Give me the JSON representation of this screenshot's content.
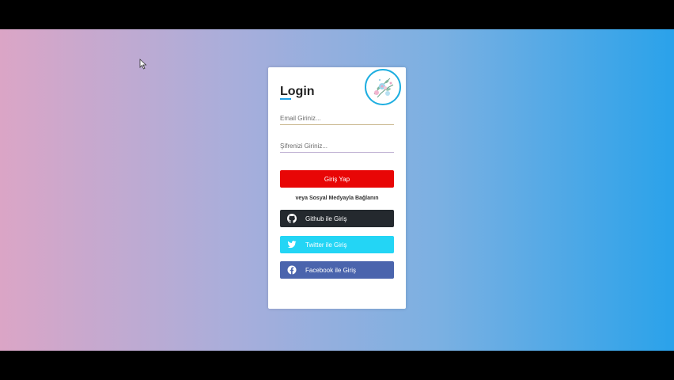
{
  "login": {
    "title": "Login",
    "email_placeholder": "Email Giriniz...",
    "password_placeholder": "Şifrenizi Giriniz...",
    "submit_label": "Giriş Yap",
    "social_text": "veya Sosyal Medyayla Bağlanın"
  },
  "social": {
    "github_label": "Github ile Giriş",
    "twitter_label": "Twitter ile Giriş",
    "facebook_label": "Facebook ile Giriş"
  },
  "colors": {
    "submit": "#e80606",
    "github": "#24292e",
    "twitter": "#23d5f5",
    "facebook": "#4a64ad",
    "accent": "#1ea0e6"
  },
  "icons": {
    "github": "github-icon",
    "twitter": "twitter-icon",
    "facebook": "facebook-icon",
    "logo": "floral-logo"
  }
}
